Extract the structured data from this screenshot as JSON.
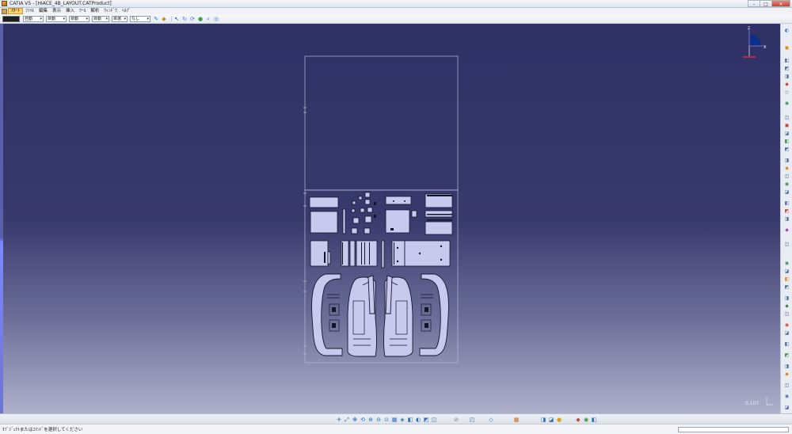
{
  "window": {
    "title": "CATIA V5 - [HIACE_4B_LAYOUT.CATProduct]",
    "minimize": "–",
    "maximize": "□",
    "close": "✕"
  },
  "menu": {
    "items": [
      {
        "label": "ｽﾀｰﾄ",
        "active": true
      },
      {
        "label": "ﾌｧｲﾙ"
      },
      {
        "label": "編集"
      },
      {
        "label": "表示"
      },
      {
        "label": "挿入"
      },
      {
        "label": "ﾂｰﾙ"
      },
      {
        "label": "解析"
      },
      {
        "label": "ｳｨﾝﾄﾞｳ"
      },
      {
        "label": "ﾍﾙﾌﾟ"
      }
    ]
  },
  "toolbar": {
    "line_color": "#1e1e1e",
    "combos": [
      "自動",
      "目動",
      "目動",
      "目動",
      "目選",
      "なし"
    ]
  },
  "viewport": {
    "zoom_value": "0.107",
    "compass_x": "x",
    "compass_z": "z"
  },
  "colors": {
    "part_fill": "#c8c9ef",
    "part_stroke": "#15152a",
    "frame_stroke": "#b8badb"
  },
  "status": {
    "text": "ｵﾌﾞｼﾞｪｸﾄまたはｺﾏﾝﾄﾞを選択してください"
  }
}
